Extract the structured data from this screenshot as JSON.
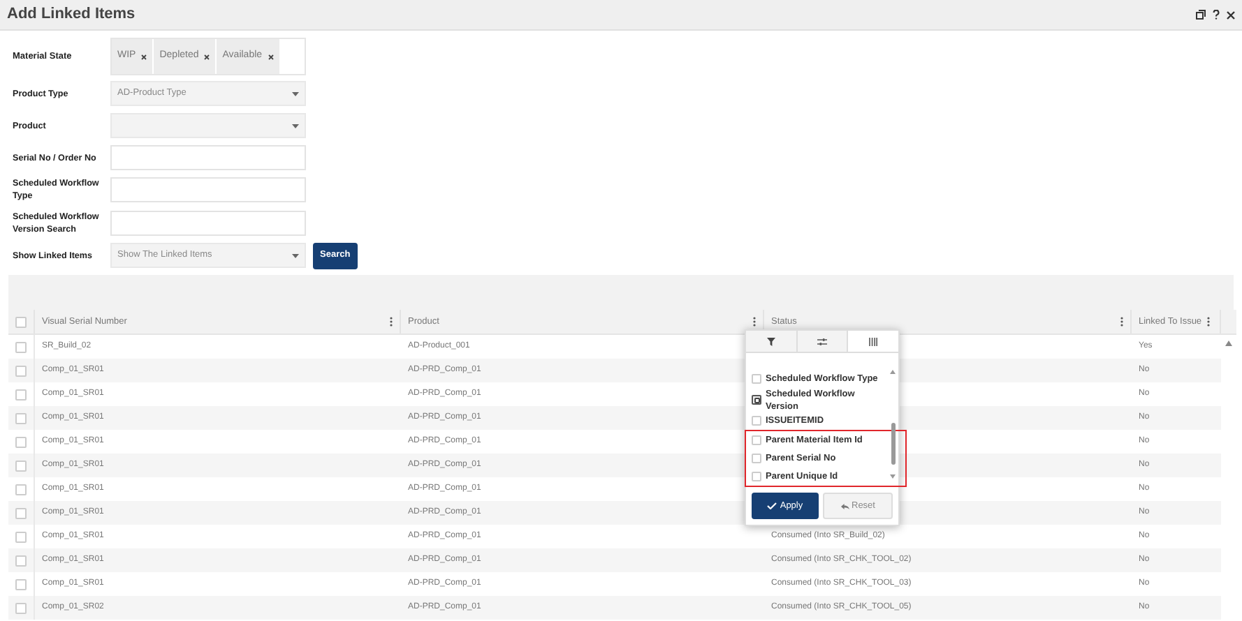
{
  "window": {
    "title": "Add Linked Items"
  },
  "form": {
    "material_state": {
      "label": "Material State",
      "tags": [
        "WIP",
        "Depleted",
        "Available"
      ]
    },
    "fields": [
      {
        "kind": "select",
        "label": "Product Type",
        "value": "AD-Product Type"
      },
      {
        "kind": "select",
        "label": "Product"
      },
      {
        "kind": "text",
        "label": "Serial No / Order No"
      },
      {
        "kind": "text",
        "label": "Scheduled Workflow Type"
      },
      {
        "kind": "text",
        "label": "Scheduled Workflow Version Search"
      },
      {
        "kind": "select",
        "label": "Show Linked Items",
        "value": "Show The Linked Items"
      }
    ],
    "search_button": "Search"
  },
  "table": {
    "all_checked": false,
    "columns": [
      "Visual Serial Number",
      "Product",
      "Status",
      "Linked To Issue"
    ],
    "rows": [
      {
        "checked": false,
        "serial": "SR_Build_02",
        "product": "AD-Product_001",
        "linked": "Yes"
      },
      {
        "checked": false,
        "serial": "Comp_01_SR01",
        "product": "AD-PRD_Comp_01",
        "linked": "No"
      },
      {
        "checked": false,
        "serial": "Comp_01_SR01",
        "product": "AD-PRD_Comp_01",
        "linked": "No"
      },
      {
        "checked": false,
        "serial": "Comp_01_SR01",
        "product": "AD-PRD_Comp_01",
        "linked": "No"
      },
      {
        "checked": false,
        "serial": "Comp_01_SR01",
        "product": "AD-PRD_Comp_01",
        "linked": "No"
      },
      {
        "checked": false,
        "serial": "Comp_01_SR01",
        "product": "AD-PRD_Comp_01",
        "linked": "No"
      },
      {
        "checked": false,
        "serial": "Comp_01_SR01",
        "product": "AD-PRD_Comp_01",
        "linked": "No"
      },
      {
        "checked": false,
        "serial": "Comp_01_SR01",
        "product": "AD-PRD_Comp_01",
        "linked": "No"
      },
      {
        "checked": false,
        "serial": "Comp_01_SR01",
        "product": "AD-PRD_Comp_01",
        "status": "Consumed (Into SR_Build_02)",
        "linked": "No"
      },
      {
        "checked": false,
        "serial": "Comp_01_SR01",
        "product": "AD-PRD_Comp_01",
        "status": "Consumed (Into SR_CHK_TOOL_02)",
        "linked": "No"
      },
      {
        "checked": false,
        "serial": "Comp_01_SR01",
        "product": "AD-PRD_Comp_01",
        "status": "Consumed (Into SR_CHK_TOOL_03)",
        "linked": "No"
      },
      {
        "checked": false,
        "serial": "Comp_01_SR02",
        "product": "AD-PRD_Comp_01",
        "status": "Consumed (Into SR_CHK_TOOL_05)",
        "linked": "No"
      }
    ]
  },
  "column_menu": {
    "tabs": [
      {
        "kind": "filter",
        "selected": false
      },
      {
        "kind": "settings",
        "selected": false
      },
      {
        "kind": "columns",
        "selected": true
      }
    ],
    "items": [
      {
        "label": "Scheduled Workflow Type",
        "checked": false,
        "focused": false,
        "highlighted": false
      },
      {
        "label": "Scheduled Workflow Version",
        "checked": false,
        "focused": true,
        "highlighted": false
      },
      {
        "label": "ISSUEITEMID",
        "checked": false,
        "focused": false,
        "highlighted": false
      },
      {
        "label": "Parent Material Item Id",
        "checked": false,
        "focused": false,
        "highlighted": true
      },
      {
        "label": "Parent Serial No",
        "checked": false,
        "focused": false,
        "highlighted": true
      },
      {
        "label": "Parent Unique Id",
        "checked": false,
        "focused": false,
        "highlighted": true
      }
    ],
    "apply": "Apply",
    "reset": "Reset"
  }
}
